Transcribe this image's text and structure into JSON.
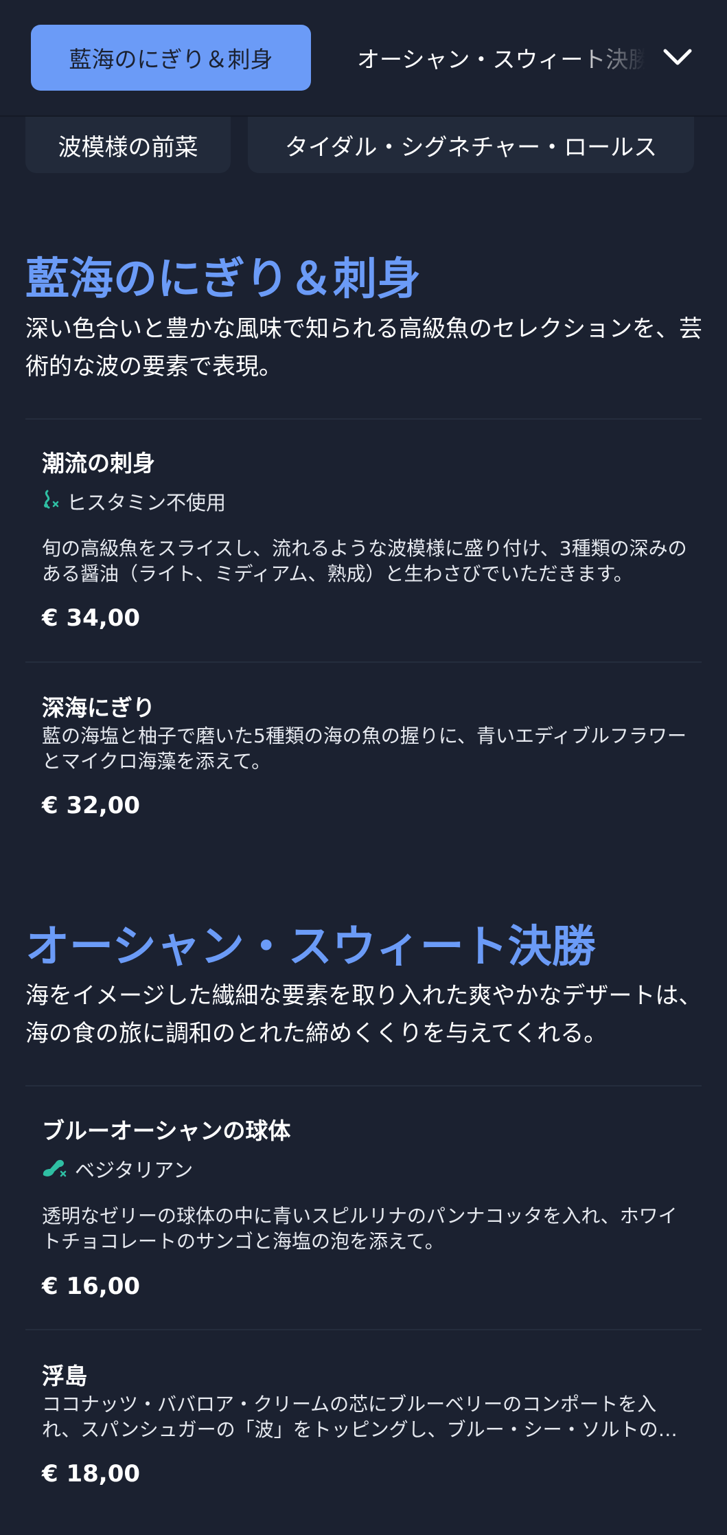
{
  "nav": {
    "active_tab": "藍海のにぎり＆刺身",
    "next_tab": "オーシャン・スウィート決勝"
  },
  "subtabs": [
    "波模様の前菜",
    "タイダル・シグネチャー・ロールス"
  ],
  "sections": [
    {
      "title": "藍海のにぎり＆刺身",
      "description": "深い色合いと豊かな風味で知られる高級魚のセレクションを、芸術的な波の要素で表現。",
      "items": [
        {
          "name": "潮流の刺身",
          "tag": "ヒスタミン不使用",
          "tag_icon": "histamine-free-icon",
          "description": "旬の高級魚をスライスし、流れるような波模様に盛り付け、3種類の深みのある醤油（ライト、ミディアム、熟成）と生わさびでいただきます。",
          "price": "€ 34,00"
        },
        {
          "name": "深海にぎり",
          "description": "藍の海塩と柚子で磨いた5種類の海の魚の握りに、青いエディブルフラワーとマイクロ海藻を添えて。",
          "price": "€ 32,00"
        }
      ]
    },
    {
      "title": "オーシャン・スウィート決勝",
      "description": "海をイメージした繊細な要素を取り入れた爽やかなデザートは、海の食の旅に調和のとれた締めくくりを与えてくれる。",
      "items": [
        {
          "name": "ブルーオーシャンの球体",
          "tag": "ベジタリアン",
          "tag_icon": "vegetarian-icon",
          "description": "透明なゼリーの球体の中に青いスピルリナのパンナコッタを入れ、ホワイトチョコレートのサンゴと海塩の泡を添えて。",
          "price": "€ 16,00"
        },
        {
          "name": "浮島",
          "description": "ココナッツ・ババロア・クリームの芯にブルーベリーのコンポートを入れ、スパンシュガーの「波」をトッピングし、ブルー・シー・ソルトのキャラメルソースで仕上げました。",
          "price": "€ 18,00"
        }
      ]
    }
  ],
  "colors": {
    "background": "#1b2130",
    "accent": "#6b9bf7",
    "chip": "#222a3a",
    "tag_icon": "#2fbfa3"
  }
}
